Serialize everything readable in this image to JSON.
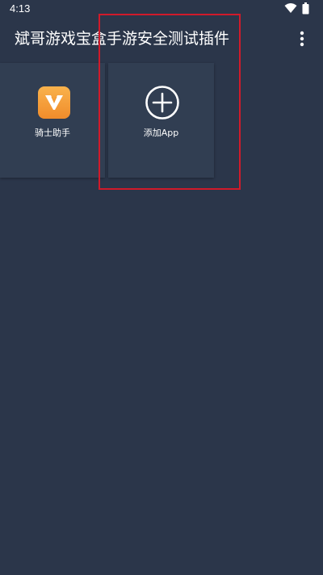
{
  "status_bar": {
    "time": "4:13",
    "icons": [
      "wifi-icon",
      "battery-icon"
    ]
  },
  "app_bar": {
    "title": "斌哥游戏宝盒手游安全测试插件",
    "menu_icon": "more-vert-icon"
  },
  "apps": [
    {
      "label": "骑士助手",
      "icon": "knight-v-logo-icon",
      "icon_color": "#f5a03a"
    },
    {
      "label": "添加App",
      "icon": "add-circle-icon"
    }
  ],
  "colors": {
    "background": "#2b364a",
    "tile": "#313e52",
    "highlight": "#d11a2a"
  }
}
